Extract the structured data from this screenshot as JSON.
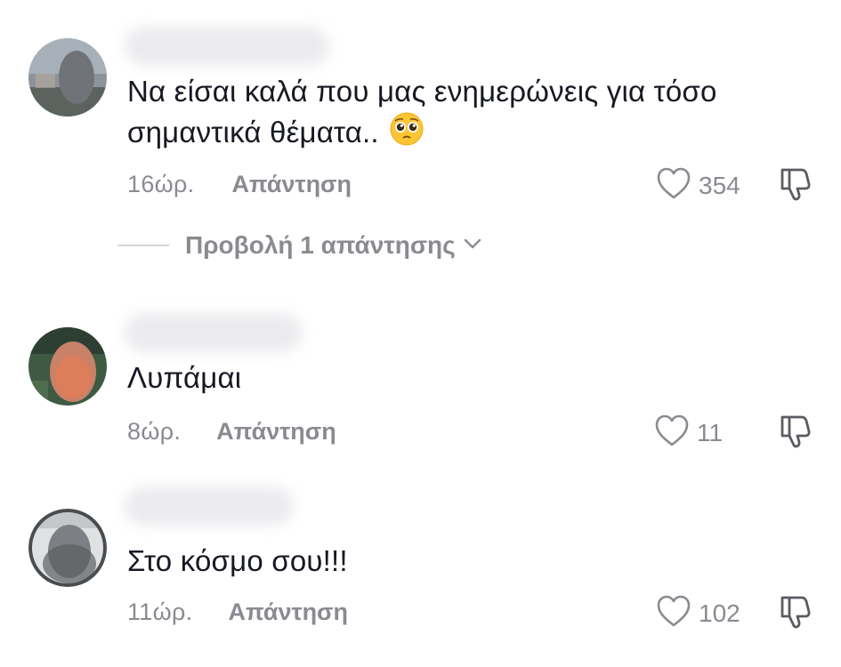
{
  "comments": [
    {
      "text": "Να είσαι καλά που μας ενημερώνεις για τόσο σημαντικά θέματα..",
      "text_line1": "Να είσαι καλά που μας ενημερώνεις για τόσο",
      "text_line2": "σημαντικά θέματα..",
      "emoji": "pleading-face",
      "time": "16ώρ.",
      "reply_label": "Απάντηση",
      "likes": "354"
    },
    {
      "text": "Λυπάμαι",
      "time": "8ώρ.",
      "reply_label": "Απάντηση",
      "likes": "11"
    },
    {
      "text": "Στο κόσμο σου!!!",
      "time": "11ώρ.",
      "reply_label": "Απάντηση",
      "likes": "102"
    }
  ],
  "view_replies": {
    "label": "Προβολή 1 απάντησης"
  },
  "colors": {
    "text": "#161823",
    "muted": "#8a8b91",
    "divider": "#d6d6da"
  },
  "icons": {
    "like": "heart-outline-icon",
    "dislike": "thumbs-down-icon",
    "expand": "chevron-down-icon"
  }
}
